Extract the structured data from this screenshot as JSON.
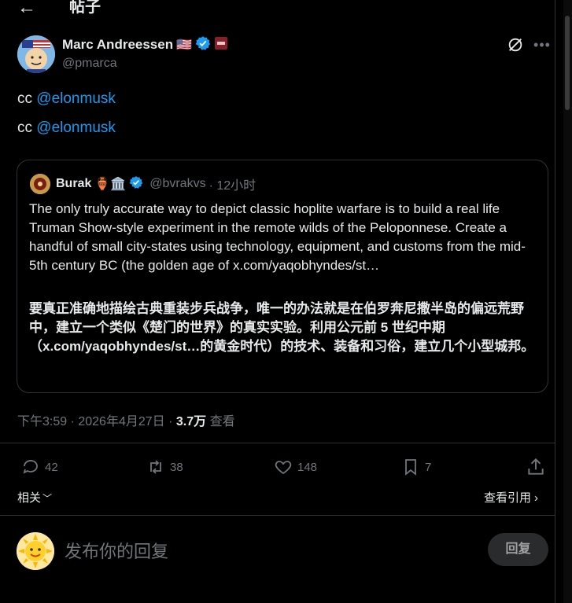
{
  "header": {
    "title": "帖子"
  },
  "post": {
    "author_name": "Marc Andreessen",
    "flag": "🇺🇸",
    "handle": "@pmarca",
    "lines": [
      {
        "prefix": "cc ",
        "mention": "@elonmusk"
      },
      {
        "prefix": "cc ",
        "mention": "@elonmusk"
      }
    ]
  },
  "quote": {
    "author_name": "Burak",
    "emoji": "🏺🏛️",
    "handle": "@bvrakvs",
    "time": "· 12小时",
    "text": "The only truly accurate way to depict classic hoplite warfare is to build a real life Truman Show-style experiment in the remote wilds of the Peloponnese. Create a handful of small city-states using technology, equipment, and customs from the mid-5th century BC (the golden age of x.com/yaqobhyndes/st…",
    "translation": "要真正准确地描绘古典重装步兵战争，唯一的办法就是在伯罗奔尼撒半岛的偏远荒野中，建立一个类似《楚门的世界》的真实实验。利用公元前 5 世纪中期（x.com/yaqobhyndes/st…的黄金时代）的技术、装备和习俗，建立几个小型城邦。"
  },
  "meta": {
    "time": "下午3:59 · 2026年4月27日 · ",
    "views_count": "3.7万",
    "views_label": " 查看"
  },
  "actions": {
    "replies": "42",
    "reposts": "38",
    "likes": "148",
    "bookmarks": "7"
  },
  "links": {
    "related": "相关",
    "view_quotes": "查看引用"
  },
  "reply": {
    "placeholder": "发布你的回复",
    "button": "回复"
  },
  "colors": {
    "accent": "#1d9bf0",
    "muted": "#71767b",
    "background": "#000000"
  }
}
